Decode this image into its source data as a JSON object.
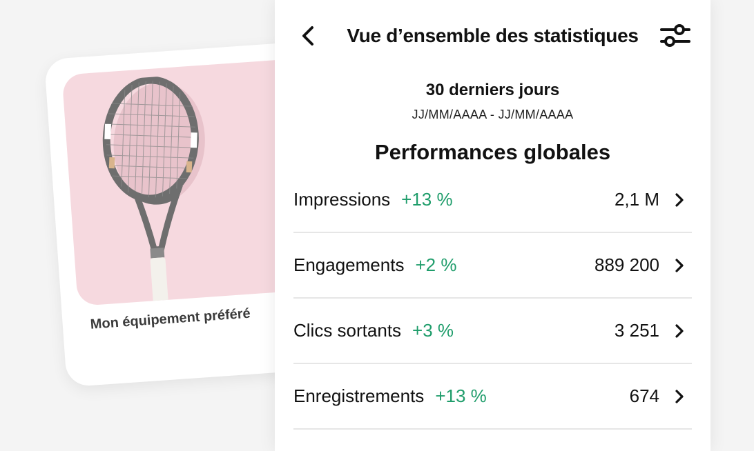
{
  "pin_card": {
    "caption": "Mon équipement préféré",
    "image_icon": "tennis-racket-icon"
  },
  "header": {
    "back_icon": "chevron-left-icon",
    "title": "Vue d’ensemble des statistiques",
    "filter_icon": "sliders-icon"
  },
  "date_range": {
    "label": "30 derniers jours",
    "value": "JJ/MM/AAAA - JJ/MM/AAAA"
  },
  "section": {
    "title": "Performances globales"
  },
  "metrics": [
    {
      "name": "Impressions",
      "change": "+13 %",
      "value": "2,1 M"
    },
    {
      "name": "Engagements",
      "change": "+2 %",
      "value": "889 200"
    },
    {
      "name": "Clics sortants",
      "change": "+3 %",
      "value": "3 251"
    },
    {
      "name": "Enregistrements",
      "change": "+13 %",
      "value": "674"
    }
  ],
  "colors": {
    "positive_change": "#1f9d6b",
    "pin_background": "#f6d9df",
    "divider": "#e6e6e6"
  }
}
